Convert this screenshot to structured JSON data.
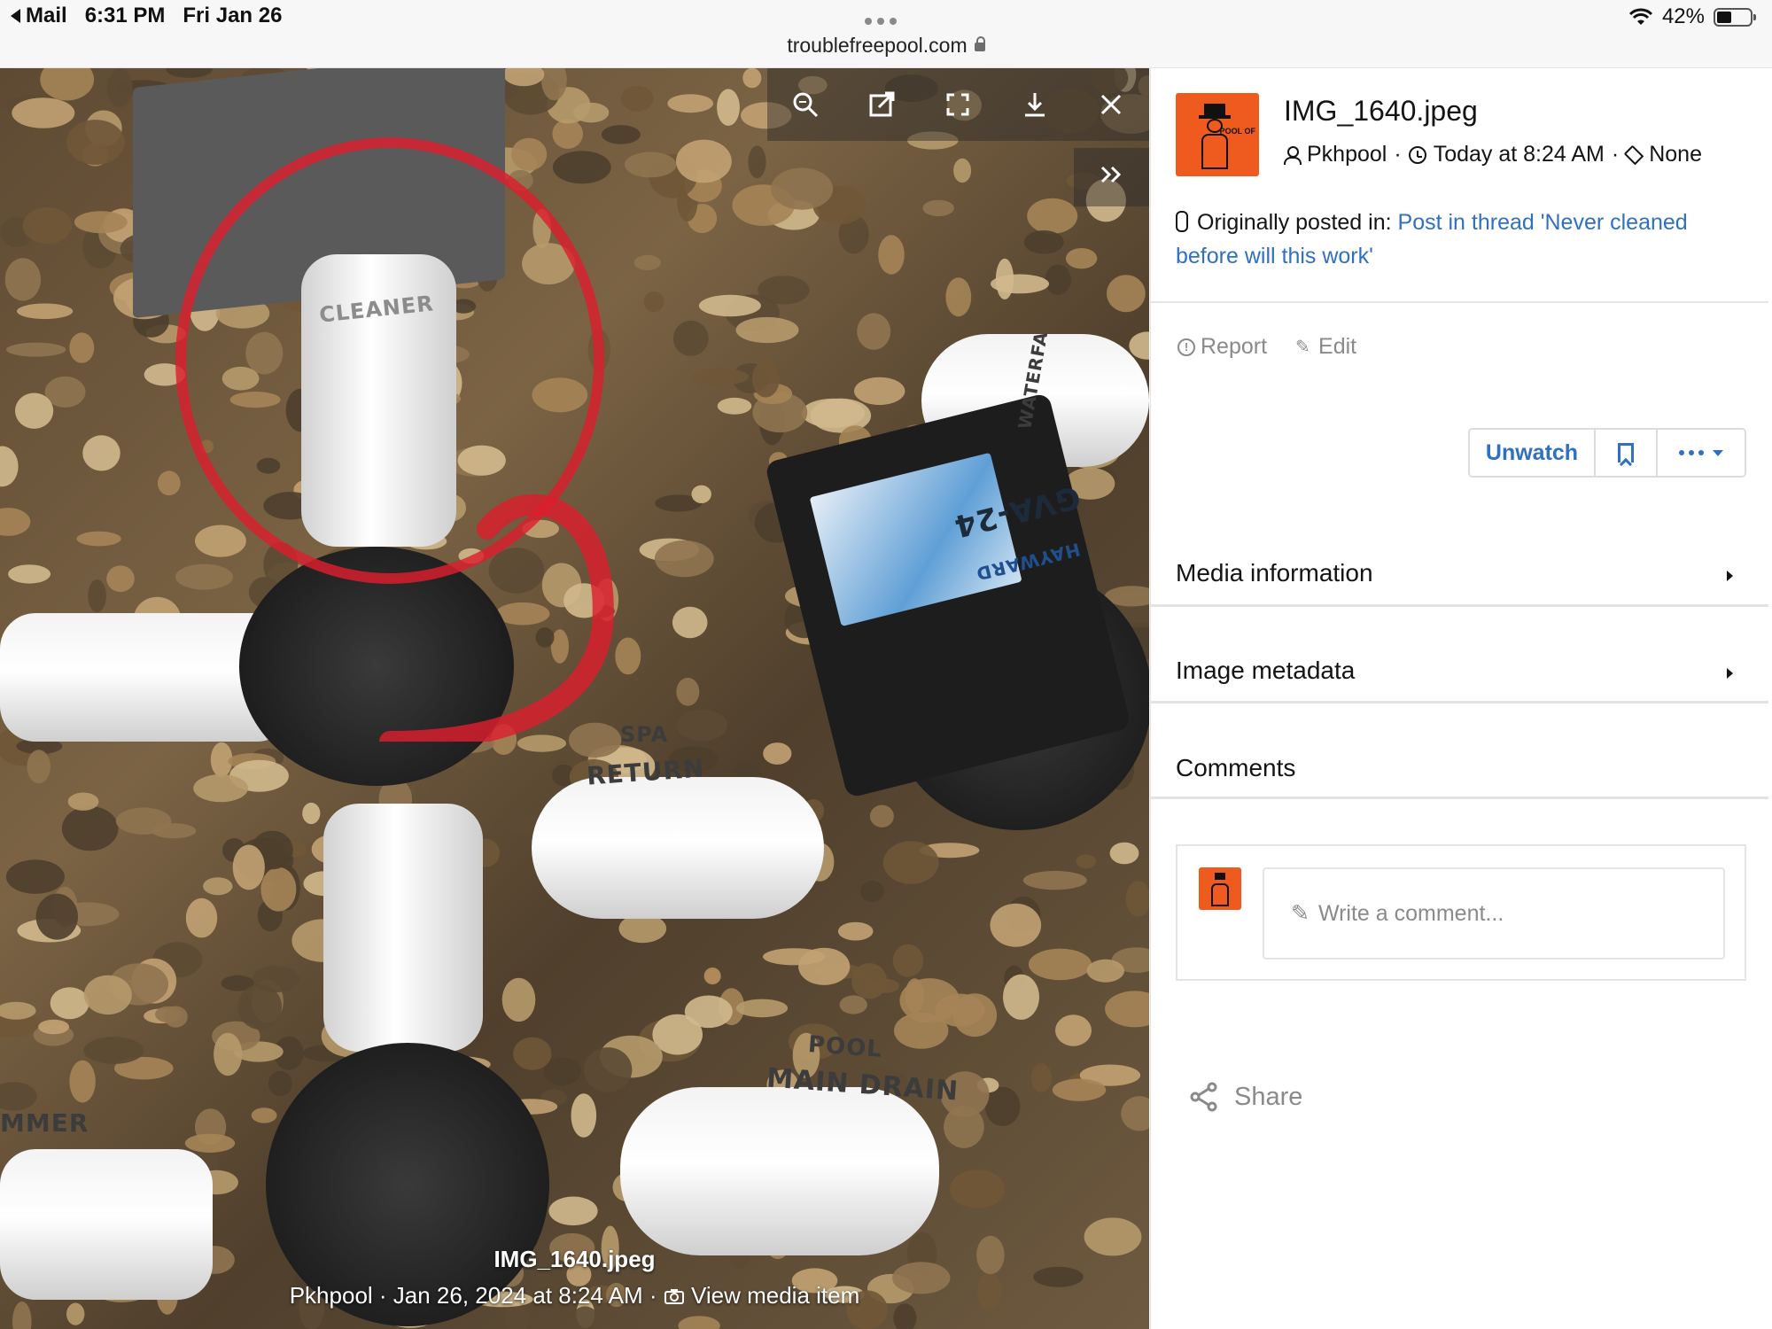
{
  "status_bar": {
    "back_app": "Mail",
    "time": "6:31 PM",
    "date": "Fri Jan 26",
    "battery": "42%",
    "battery_level": 0.42,
    "url": "troublefreepool.com"
  },
  "photo": {
    "labels": {
      "cleaner": "CLEANER",
      "waterfall": "WATERFA",
      "spa": "SPA",
      "return": "RETURN",
      "pool": "POOL",
      "main_drain": "MAIN DRAIN",
      "skimmer": "MMER",
      "actuator_model": "GVA-24",
      "actuator_brand": "HAYWARD"
    },
    "annotation_color": "#dc1e2d"
  },
  "viewer_toolbar": {
    "icons": [
      "zoom-icon",
      "open-external-icon",
      "fullscreen-icon",
      "download-icon",
      "close-icon"
    ],
    "next_icon": "double-chevron-right-icon"
  },
  "caption": {
    "title": "IMG_1640.jpeg",
    "meta": "Pkhpool · Jan 26, 2024 at 8:24 AM · ",
    "view_link": "View media item"
  },
  "panel": {
    "file_name": "IMG_1640.jpeg",
    "author": "Pkhpool",
    "time": "Today at 8:24 AM",
    "tags": "None",
    "originally_posted_label": "Originally posted in:",
    "thread_link": "Post in thread 'Never cleaned before will this work'",
    "report_label": "Report",
    "edit_label": "Edit",
    "unwatch_label": "Unwatch",
    "sections": [
      {
        "title": "Media information"
      },
      {
        "title": "Image metadata"
      },
      {
        "title": "Comments"
      }
    ],
    "comment_placeholder": "Write a comment...",
    "share_label": "Share",
    "avatar_text": "POOL OF",
    "accent_color": "#2f70c2",
    "avatar_color": "#ef5a1e"
  }
}
